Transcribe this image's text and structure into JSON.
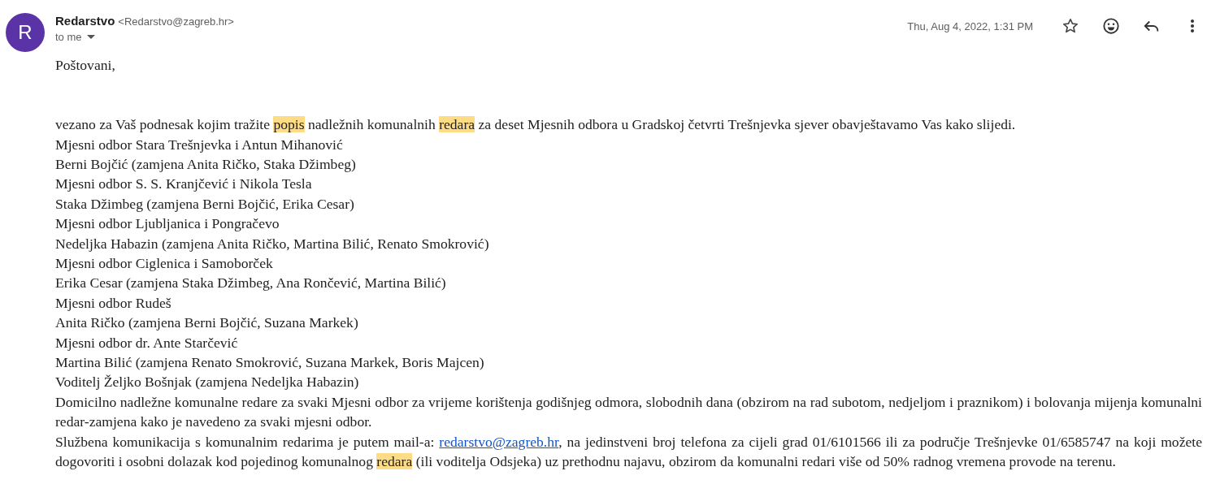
{
  "sender": {
    "initial": "R",
    "name": "Redarstvo",
    "email": "<Redarstvo@zagreb.hr>",
    "recipient": "to me",
    "date": "Thu, Aug 4, 2022, 1:31 PM",
    "starred": false
  },
  "body": [
    {
      "kind": "greeting",
      "segments": [
        {
          "kind": "plain",
          "text": "Poštovani,"
        }
      ]
    },
    {
      "kind": "line",
      "segments": [
        {
          "kind": "plain",
          "text": "vezano za Vaš podnesak kojim tražite "
        },
        {
          "kind": "highlight",
          "text": "popis"
        },
        {
          "kind": "plain",
          "text": " nadležnih komunalnih "
        },
        {
          "kind": "highlight",
          "text": "redara"
        },
        {
          "kind": "plain",
          "text": " za deset Mjesnih odbora u Gradskoj četvrti Trešnjevka sjever obavještavamo Vas kako slijedi."
        }
      ]
    },
    {
      "kind": "line",
      "segments": [
        {
          "kind": "plain",
          "text": "Mjesni odbor Stara Trešnjevka i Antun Mihanović"
        }
      ]
    },
    {
      "kind": "line",
      "segments": [
        {
          "kind": "plain",
          "text": "Berni Bojčić (zamjena Anita Ričko, Staka Džimbeg)"
        }
      ]
    },
    {
      "kind": "line",
      "segments": [
        {
          "kind": "plain",
          "text": "Mjesni odbor S. S. Kranjčević i Nikola Tesla"
        }
      ]
    },
    {
      "kind": "line",
      "segments": [
        {
          "kind": "plain",
          "text": "Staka Džimbeg (zamjena Berni Bojčić, Erika Cesar)"
        }
      ]
    },
    {
      "kind": "line",
      "segments": [
        {
          "kind": "plain",
          "text": "Mjesni odbor Ljubljanica i Pongračevo"
        }
      ]
    },
    {
      "kind": "line",
      "segments": [
        {
          "kind": "plain",
          "text": "Nedeljka Habazin (zamjena Anita Ričko, Martina Bilić, Renato Smokrović)"
        }
      ]
    },
    {
      "kind": "line",
      "segments": [
        {
          "kind": "plain",
          "text": "Mjesni odbor Ciglenica i Samoborček"
        }
      ]
    },
    {
      "kind": "line",
      "segments": [
        {
          "kind": "plain",
          "text": "Erika Cesar (zamjena Staka Džimbeg, Ana Rončević, Martina Bilić)"
        }
      ]
    },
    {
      "kind": "line",
      "segments": [
        {
          "kind": "plain",
          "text": "Mjesni odbor Rudeš"
        }
      ]
    },
    {
      "kind": "line",
      "segments": [
        {
          "kind": "plain",
          "text": "Anita Ričko (zamjena Berni Bojčić, Suzana Markek)"
        }
      ]
    },
    {
      "kind": "line",
      "segments": [
        {
          "kind": "plain",
          "text": "Mjesni odbor dr. Ante Starčević"
        }
      ]
    },
    {
      "kind": "line",
      "segments": [
        {
          "kind": "plain",
          "text": "Martina Bilić (zamjena Renato Smokrović, Suzana Markek, Boris Majcen)"
        }
      ]
    },
    {
      "kind": "line",
      "segments": [
        {
          "kind": "plain",
          "text": "Voditelj Željko Bošnjak (zamjena Nedeljka Habazin)"
        }
      ]
    },
    {
      "kind": "line",
      "segments": [
        {
          "kind": "plain",
          "text": "Domicilno nadležne komunalne redare za svaki Mjesni odbor za vrijeme korištenja godišnjeg odmora, slobodnih dana (obzirom na rad subotom, nedjeljom i praznikom) i bolovanja mijenja komunalni redar-zamjena kako je navedeno za svaki mjesni odbor."
        }
      ]
    },
    {
      "kind": "line",
      "segments": [
        {
          "kind": "plain",
          "text": "Službena komunikacija s komunalnim redarima je putem mail-a: "
        },
        {
          "kind": "link",
          "text": "redarstvo@zagreb.hr"
        },
        {
          "kind": "plain",
          "text": ", na jedinstveni broj telefona za cijeli grad 01/6101566 ili za područje Trešnjevke 01/6585747 na koji možete dogovoriti i osobni dolazak kod pojedinog komunalnog "
        },
        {
          "kind": "highlight",
          "text": "redara"
        },
        {
          "kind": "plain",
          "text": " (ili voditelja Odsjeka) uz prethodnu najavu, obzirom da komunalni redari više od 50% radnog vremena provode na terenu."
        }
      ]
    }
  ]
}
